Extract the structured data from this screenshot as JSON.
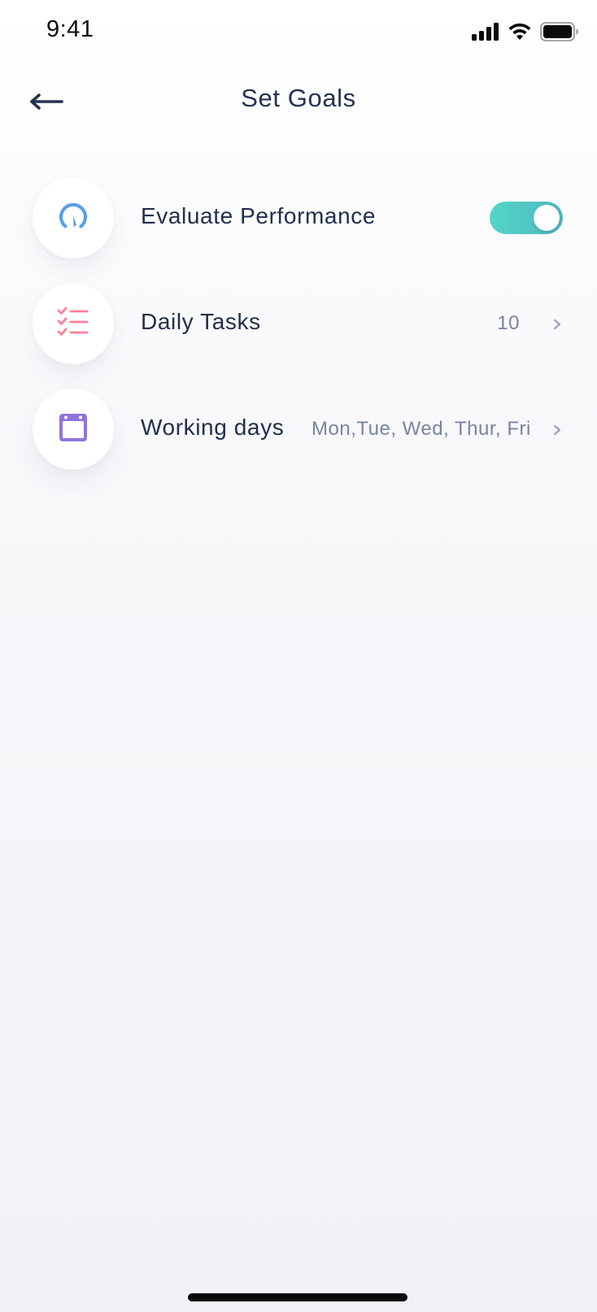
{
  "status_bar": {
    "time": "9:41",
    "icons": [
      "cellular-signal-icon",
      "wifi-icon",
      "battery-icon"
    ]
  },
  "nav": {
    "title": "Set Goals",
    "back_icon": "back-arrow-icon"
  },
  "settings": [
    {
      "label": "Evaluate Performance",
      "icon": "gauge-icon",
      "icon_color": "#5aa0e6",
      "control": "toggle",
      "toggle_on": true
    },
    {
      "label": "Daily Tasks",
      "icon": "checklist-icon",
      "icon_color": "#ff7f96",
      "control": "value",
      "value": "10"
    },
    {
      "label": "Working days",
      "icon": "calendar-icon",
      "icon_color": "#8f74dc",
      "control": "value",
      "value": "Mon,Tue, Wed, Thur, Fri"
    }
  ],
  "colors": {
    "text_primary": "#222f4c",
    "text_secondary": "#7a84a0",
    "toggle_on": "#53d6c6"
  }
}
